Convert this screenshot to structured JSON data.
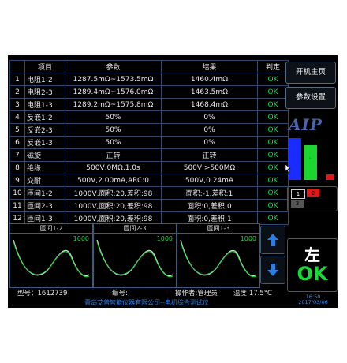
{
  "table": {
    "headers": [
      "",
      "项目",
      "参数",
      "结果",
      "判定"
    ],
    "rows": [
      [
        "1",
        "电阻1-2",
        "1287.5mΩ~1573.5mΩ",
        "1460.4mΩ",
        "OK"
      ],
      [
        "2",
        "电阻2-3",
        "1289.4mΩ~1576.0mΩ",
        "1463.5mΩ",
        "OK"
      ],
      [
        "3",
        "电阻1-3",
        "1289.2mΩ~1575.8mΩ",
        "1468.4mΩ",
        "OK"
      ],
      [
        "4",
        "反嵌1-2",
        "50%",
        "0%",
        "OK"
      ],
      [
        "5",
        "反嵌2-3",
        "50%",
        "0%",
        "OK"
      ],
      [
        "6",
        "反嵌1-3",
        "50%",
        "0%",
        "OK"
      ],
      [
        "7",
        "磁旋",
        "正转",
        "正转",
        "OK"
      ],
      [
        "8",
        "绝缘",
        "500V,0MΩ,1.0s",
        "500V,>500MΩ",
        "OK"
      ],
      [
        "9",
        "交耐",
        "500V,2.00mA,ARC:0",
        "500V,0.24mA",
        "OK"
      ],
      [
        "10",
        "匝间1-2",
        "1000V,面积:20,差积:98",
        "面积:-1,差积:1",
        "OK"
      ],
      [
        "11",
        "匝间2-3",
        "1000V,面积:20,差积:98",
        "面积:0,差积:0",
        "OK"
      ],
      [
        "12",
        "匝间1-3",
        "1000V,面积:20,差积:98",
        "面积:0,差积:1",
        "OK"
      ]
    ]
  },
  "waves": [
    {
      "label": "匝间1-2",
      "count": "1000"
    },
    {
      "label": "匝间2-3",
      "count": "1000"
    },
    {
      "label": "匝间1-3",
      "count": "1000"
    }
  ],
  "status": {
    "model": "型号：1612739",
    "serial": "编号:",
    "operator": "操作者:管理员",
    "temperature": "温度:17.5°C"
  },
  "footer": "青岛艾普智能仪器有限公司--电机综合测试仪",
  "clock": {
    "time": "16:50",
    "date": "2017/03/06"
  },
  "side": {
    "home_button": "开机主页",
    "settings_button": "参数设置",
    "logo": "AIP",
    "legend": {
      "l1": "1",
      "l2": "2",
      "l3": "3"
    },
    "bars": {
      "blue": 0.95,
      "green": 0.78,
      "red": 0.12
    },
    "direction": "左",
    "final_result": "OK"
  },
  "colors": {
    "ok_green": "#19d83a",
    "footer_blue": "#2d7de0",
    "bar_blue": "#1a2cff",
    "bar_green": "#1bd62e",
    "bar_red": "#e01818"
  }
}
